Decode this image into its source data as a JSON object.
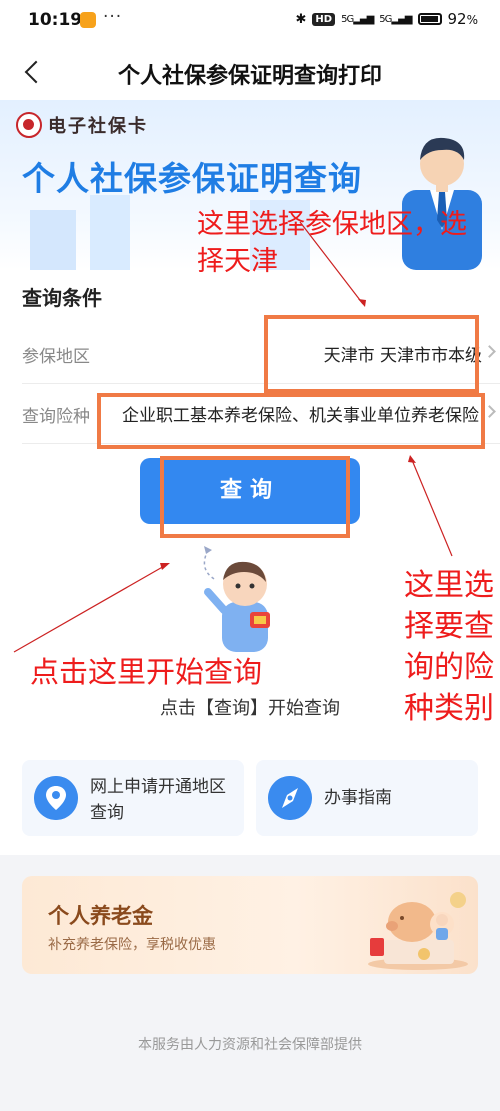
{
  "status_bar": {
    "time": "10:19",
    "dots": "···",
    "hd": "HD",
    "sig1": "5G",
    "sig2": "5G",
    "battery_text": "92",
    "battery_unit": "%"
  },
  "nav": {
    "title": "个人社保参保证明查询打印"
  },
  "banner": {
    "logo_text": "电子社保卡",
    "title": "个人社保参保证明查询"
  },
  "query": {
    "section_title": "查询条件",
    "region_label": "参保地区",
    "region_value": "天津市 天津市市本级",
    "insurance_label": "查询险种",
    "insurance_value": "企业职工基本养老保险、机关事业单位养老保险",
    "button_label": "查询",
    "hint": "点击【查询】开始查询"
  },
  "services": [
    {
      "label": "网上申请开通地区查询",
      "icon": "location-pin-icon"
    },
    {
      "label": "办事指南",
      "icon": "compass-icon"
    }
  ],
  "pension": {
    "title": "个人养老金",
    "subtitle": "补充养老保险，享税收优惠"
  },
  "footer": "本服务由人力资源和社会保障部提供",
  "annotations": {
    "region_tip_line1": "这里选择参保地区，选",
    "region_tip_line2": "择天津",
    "insurance_tip_1": "这里选",
    "insurance_tip_2": "择要查",
    "insurance_tip_3": "询的险",
    "insurance_tip_4": "种类别",
    "click_tip": "点击这里开始查询",
    "color": "#ee1c1c",
    "box_color": "#f07a45"
  },
  "colors": {
    "primary": "#3388f0",
    "title_blue": "#1f7de4"
  }
}
